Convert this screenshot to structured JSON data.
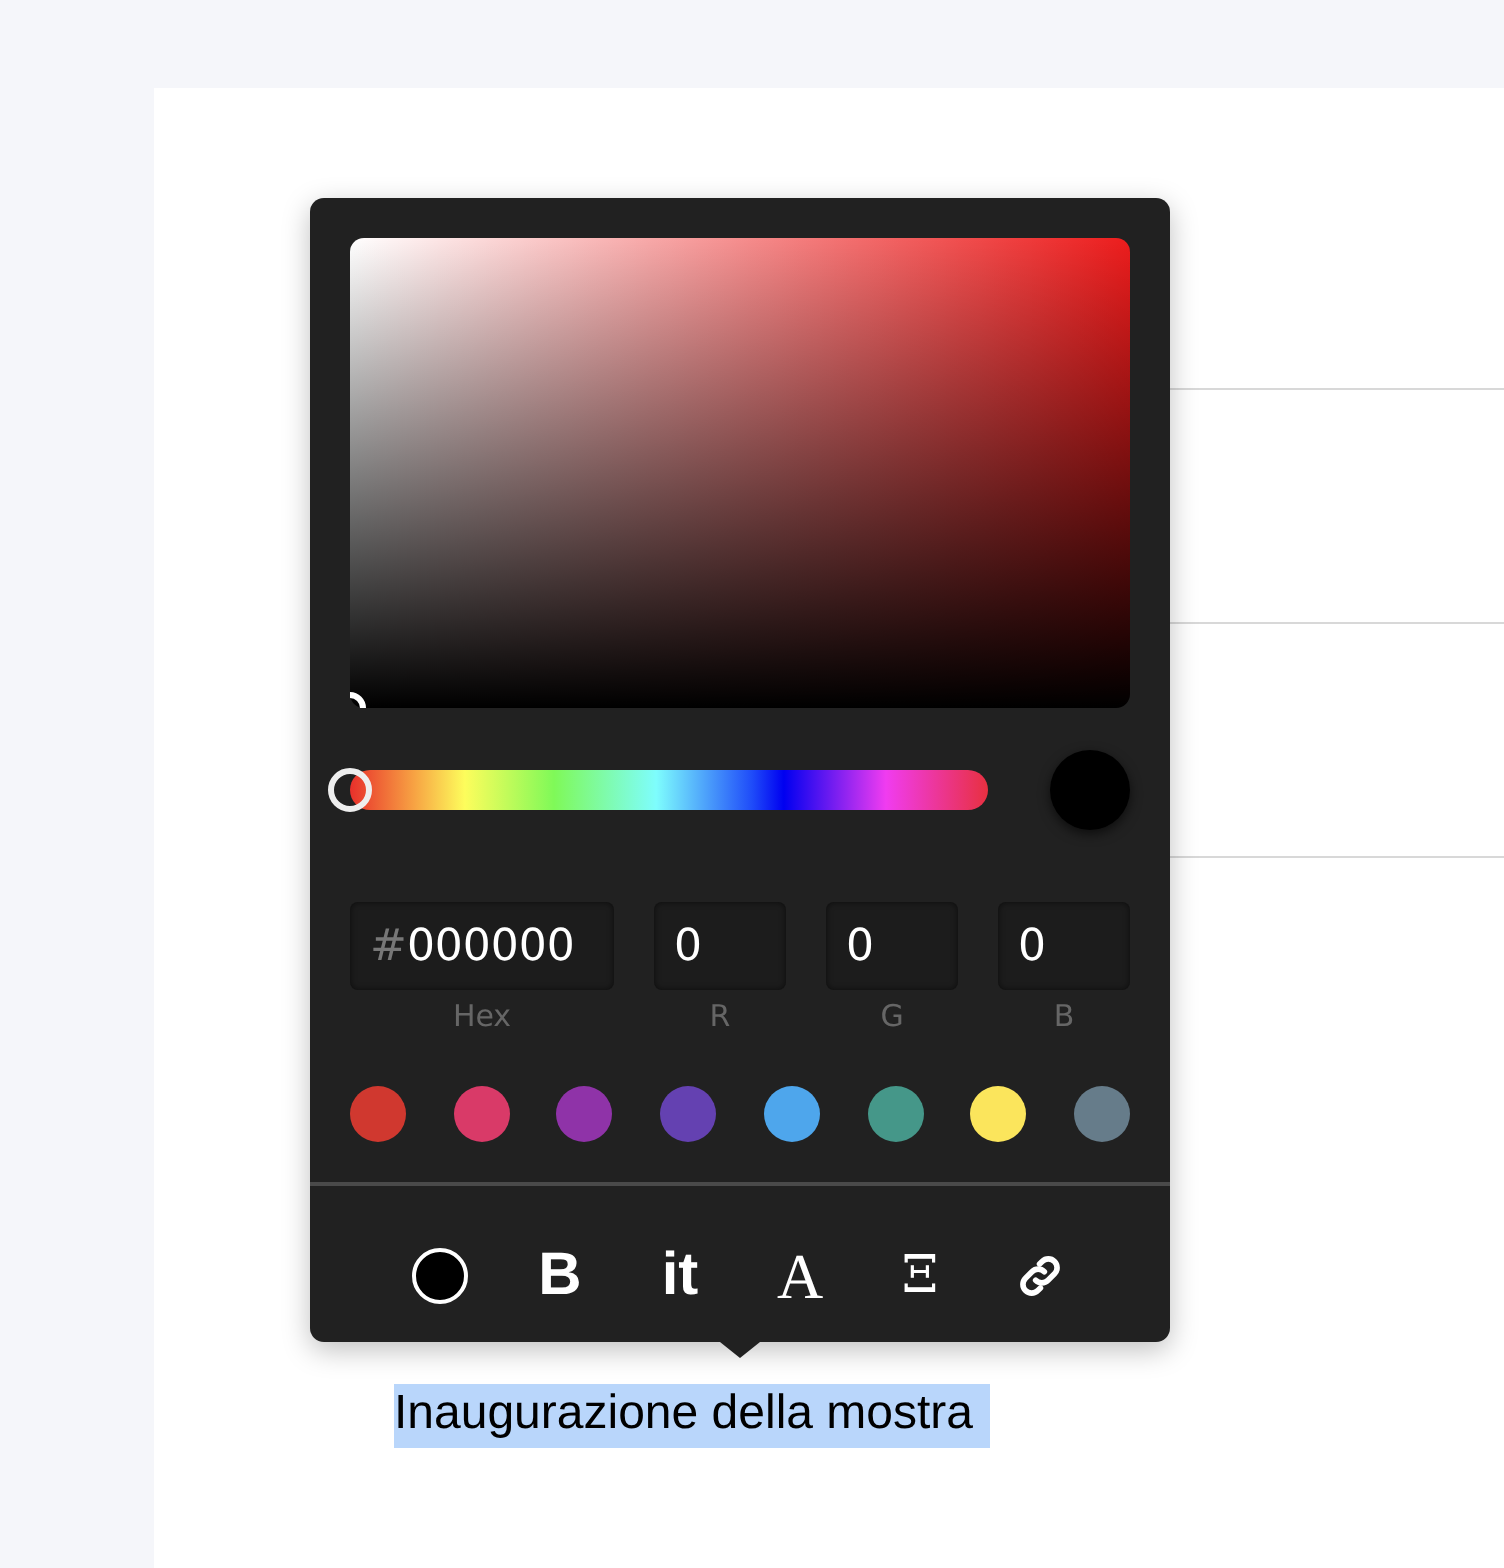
{
  "editor": {
    "selected_text": "Inaugurazione della mostra"
  },
  "color_picker": {
    "hue": {
      "level": 0
    },
    "hex": {
      "prefix": "#",
      "value": "000000",
      "label": "Hex"
    },
    "channels": [
      {
        "value": "0",
        "label": "R"
      },
      {
        "value": "0",
        "label": "G"
      },
      {
        "value": "0",
        "label": "B"
      }
    ],
    "swatches": [
      {
        "color": "#d0382f"
      },
      {
        "color": "#d93a68"
      },
      {
        "color": "#8f33a8"
      },
      {
        "color": "#6441b1"
      },
      {
        "color": "#4ea6ec"
      },
      {
        "color": "#459789"
      },
      {
        "color": "#fbe55c"
      },
      {
        "color": "#667c8a"
      }
    ]
  },
  "toolbar": [
    {
      "kind": "color"
    },
    {
      "kind": "bold",
      "label": "B"
    },
    {
      "kind": "italic",
      "label": "it"
    },
    {
      "kind": "serif",
      "label": "A"
    },
    {
      "kind": "glyph",
      "label": "Ξ"
    },
    {
      "kind": "link"
    }
  ]
}
